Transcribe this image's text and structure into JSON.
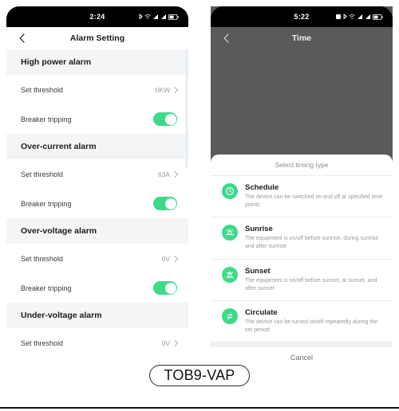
{
  "left_phone": {
    "status_bar": {
      "time": "2:24",
      "icons": [
        "bluetooth-icon",
        "wifi-icon",
        "signal-icon",
        "signal-icon-2",
        "battery-icon"
      ]
    },
    "nav": {
      "back_icon": "chevron-left-icon",
      "title": "Alarm Setting"
    },
    "sections": [
      {
        "title": "High power alarm",
        "rows": [
          {
            "label": "Set threshold",
            "value": "0KW",
            "type": "value"
          },
          {
            "label": "Breaker tripping",
            "value": "on",
            "type": "toggle"
          }
        ]
      },
      {
        "title": "Over-current alarm",
        "rows": [
          {
            "label": "Set threshold",
            "value": "63A",
            "type": "value"
          },
          {
            "label": "Breaker tripping",
            "value": "on",
            "type": "toggle"
          }
        ]
      },
      {
        "title": "Over-voltage alarm",
        "rows": [
          {
            "label": "Set threshold",
            "value": "0V",
            "type": "value"
          },
          {
            "label": "Breaker tripping",
            "value": "on",
            "type": "toggle"
          }
        ]
      },
      {
        "title": "Under-voltage alarm",
        "rows": [
          {
            "label": "Set threshold",
            "value": "0V",
            "type": "value"
          }
        ]
      }
    ]
  },
  "right_phone": {
    "status_bar": {
      "time": "5:22",
      "icons": [
        "alarm-icon",
        "bluetooth-icon",
        "wifi-icon",
        "signal-icon",
        "signal-icon-2",
        "battery-icon"
      ]
    },
    "nav": {
      "back_icon": "chevron-left-icon",
      "title": "Time"
    },
    "sheet": {
      "title": "Select timing type",
      "options": [
        {
          "icon": "clock-icon",
          "title": "Schedule",
          "desc": "The device can be switched on and off at specified time points"
        },
        {
          "icon": "sunrise-icon",
          "title": "Sunrise",
          "desc": "The equipment is on/off before sunrise, during sunrise and after sunrise"
        },
        {
          "icon": "sunset-icon",
          "title": "Sunset",
          "desc": "The equipment is on/off before sunset, at sunset, and after sunset"
        },
        {
          "icon": "circulate-icon",
          "title": "Circulate",
          "desc": "The device can be turned on/off repeatedly during the set period"
        }
      ],
      "cancel_label": "Cancel"
    }
  },
  "caption": {
    "label": "TOB9-VAP"
  },
  "colors": {
    "accent_green": "#3fd98a",
    "section_bg": "#f4f5f7",
    "dim_overlay": "#5a5a5a",
    "muted_text": "#9a9aa0"
  }
}
